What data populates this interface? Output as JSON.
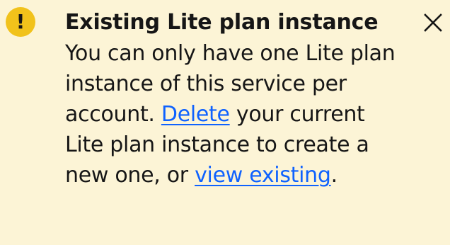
{
  "notification": {
    "kind": "warning",
    "accent_color": "#f1c21b",
    "background_color": "#fcf4d6",
    "link_color": "#0f62fe",
    "icon": "warning-exclamation-icon",
    "title": "Existing Lite plan instance",
    "subtitle_part1": "You can only have one Lite plan instance of this service per account. ",
    "delete_link": "Delete",
    "subtitle_part2": " your current Lite plan instance to create a new one, or ",
    "view_existing_link": "view existing",
    "subtitle_part3": ".",
    "close_icon": "close-icon"
  }
}
